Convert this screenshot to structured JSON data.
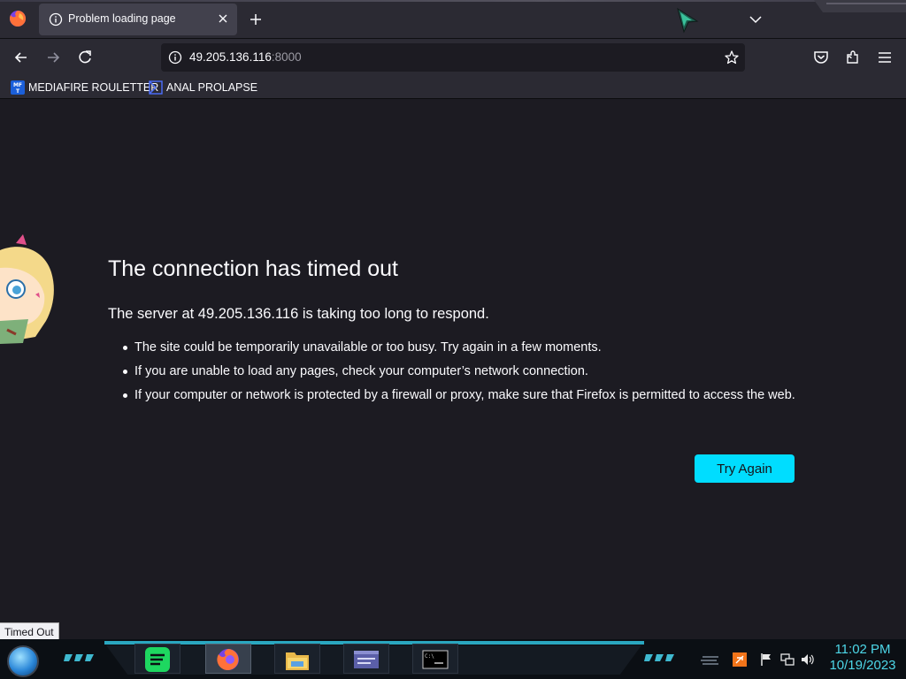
{
  "browser": {
    "tab": {
      "title": "Problem loading page"
    },
    "url": {
      "host": "49.205.136.116",
      "port": ":8000"
    },
    "bookmarks": [
      {
        "label": "MEDIAFIRE ROULETTER",
        "icon": "mediafire-icon"
      },
      {
        "label": "ANAL PROLAPSE",
        "icon": "bookmark-frame-icon"
      }
    ]
  },
  "error_page": {
    "title": "The connection has timed out",
    "subtitle": "The server at 49.205.136.116 is taking too long to respond.",
    "items": [
      "The site could be temporarily unavailable or too busy. Try again in a few moments.",
      "If you are unable to load any pages, check your computer’s network connection.",
      "If your computer or network is protected by a firewall or proxy, make sure that Firefox is permitted to access the web."
    ],
    "try_again_label": "Try Again",
    "accent_color": "#00ddff"
  },
  "status_bar": {
    "text": "Timed Out"
  },
  "taskbar": {
    "apps": [
      "spotify-icon",
      "firefox-icon",
      "file-explorer-icon",
      "window-manager-icon",
      "command-prompt-icon"
    ],
    "clock": {
      "time": "11:02 PM",
      "date": "10/19/2023"
    }
  }
}
